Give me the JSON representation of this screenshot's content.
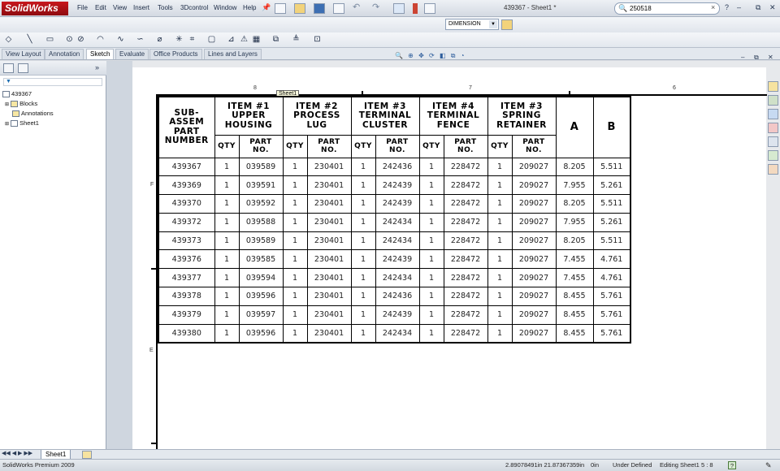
{
  "app": {
    "logo": "SolidWorks",
    "menu": [
      "File",
      "Edit",
      "View",
      "Insert",
      "Tools",
      "3Dcontrol",
      "Window",
      "Help"
    ],
    "doc_title": "439367 - Sheet1 *",
    "search": {
      "value": "250518"
    }
  },
  "toolbar2": {
    "dimension_value": "DIMENSION"
  },
  "command_tabs": [
    "View Layout",
    "Annotation",
    "Sketch",
    "Evaluate",
    "Office Products",
    "Lines and Layers"
  ],
  "active_tab": "Sketch",
  "tree": {
    "root": "439367",
    "items": [
      "Blocks",
      "Annotations",
      "Sheet1"
    ]
  },
  "sheet": {
    "tooltip": "Sheet1",
    "zone_top": [
      "8",
      "7",
      "6"
    ],
    "zone_left": [
      "F",
      "E"
    ]
  },
  "table": {
    "h_sub": "SUB-\nASSEM\nPART\nNUMBER",
    "items": [
      "ITEM #1\nUPPER\nHOUSING",
      "ITEM #2\nPROCESS\nLUG",
      "ITEM #3\nTERMINAL\nCLUSTER",
      "ITEM #4\nTERMINAL\nFENCE",
      "ITEM #3\nSPRING\nRETAINER"
    ],
    "h_a": "A",
    "h_b": "B",
    "qty": "QTY",
    "partno": "PART\nNO.",
    "rows": [
      [
        "439367",
        "1",
        "039589",
        "1",
        "230401",
        "1",
        "242436",
        "1",
        "228472",
        "1",
        "209027",
        "8.205",
        "5.511"
      ],
      [
        "439369",
        "1",
        "039591",
        "1",
        "230401",
        "1",
        "242439",
        "1",
        "228472",
        "1",
        "209027",
        "7.955",
        "5.261"
      ],
      [
        "439370",
        "1",
        "039592",
        "1",
        "230401",
        "1",
        "242439",
        "1",
        "228472",
        "1",
        "209027",
        "8.205",
        "5.511"
      ],
      [
        "439372",
        "1",
        "039588",
        "1",
        "230401",
        "1",
        "242434",
        "1",
        "228472",
        "1",
        "209027",
        "7.955",
        "5.261"
      ],
      [
        "439373",
        "1",
        "039589",
        "1",
        "230401",
        "1",
        "242434",
        "1",
        "228472",
        "1",
        "209027",
        "8.205",
        "5.511"
      ],
      [
        "439376",
        "1",
        "039585",
        "1",
        "230401",
        "1",
        "242439",
        "1",
        "228472",
        "1",
        "209027",
        "7.455",
        "4.761"
      ],
      [
        "439377",
        "1",
        "039594",
        "1",
        "230401",
        "1",
        "242434",
        "1",
        "228472",
        "1",
        "209027",
        "7.455",
        "4.761"
      ],
      [
        "439378",
        "1",
        "039596",
        "1",
        "230401",
        "1",
        "242436",
        "1",
        "228472",
        "1",
        "209027",
        "8.455",
        "5.761"
      ],
      [
        "439379",
        "1",
        "039597",
        "1",
        "230401",
        "1",
        "242439",
        "1",
        "228472",
        "1",
        "209027",
        "8.455",
        "5.761"
      ],
      [
        "439380",
        "1",
        "039596",
        "1",
        "230401",
        "1",
        "242434",
        "1",
        "228472",
        "1",
        "209027",
        "8.455",
        "5.761"
      ]
    ]
  },
  "sheet_tab": "Sheet1",
  "status": {
    "product": "SolidWorks Premium 2009",
    "coords": "2.89078491in  21.87367359in",
    "z": "0in",
    "state": "Under Defined",
    "editing": "Editing Sheet1",
    "scale": "5 : 8",
    "help": "?"
  }
}
